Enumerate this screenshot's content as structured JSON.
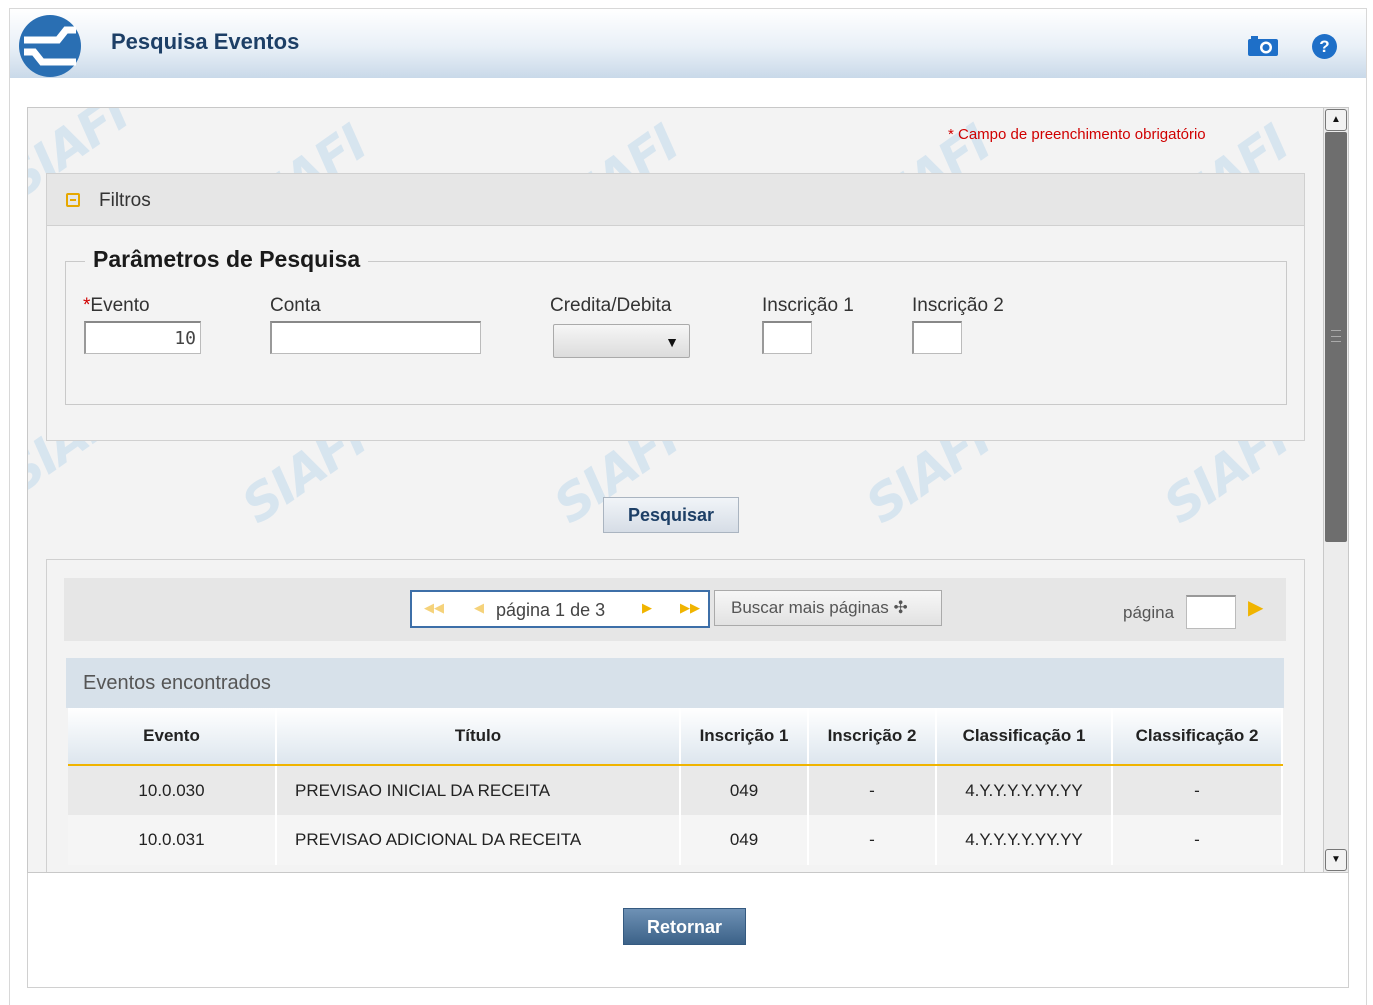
{
  "header": {
    "title": "Pesquisa Eventos",
    "help_glyph": "?"
  },
  "watermark_text": "SIAFI",
  "required_note": "* Campo de preenchimento obrigatório",
  "filters": {
    "section_label": "Filtros",
    "fieldset_legend": "Parâmetros de Pesquisa",
    "evento": {
      "label": "Evento",
      "required_mark": "*",
      "value": "10"
    },
    "conta": {
      "label": "Conta",
      "value": ""
    },
    "credita_debita": {
      "label": "Credita/Debita",
      "selected": ""
    },
    "inscricao1": {
      "label": "Inscrição 1",
      "value": ""
    },
    "inscricao2": {
      "label": "Inscrição 2",
      "value": ""
    }
  },
  "search_button": "Pesquisar",
  "pager": {
    "text": "página 1 de 3",
    "more_pages_label": "Buscar mais páginas ✣",
    "page_label": "página",
    "page_value": ""
  },
  "results": {
    "title": "Eventos encontrados",
    "columns": [
      "Evento",
      "Título",
      "Inscrição 1",
      "Inscrição 2",
      "Classificação 1",
      "Classificação 2"
    ],
    "rows": [
      [
        "10.0.030",
        "PREVISAO INICIAL DA RECEITA",
        "049",
        "-",
        "4.Y.Y.Y.Y.YY.YY",
        "-"
      ],
      [
        "10.0.031",
        "PREVISAO ADICIONAL DA RECEITA",
        "049",
        "-",
        "4.Y.Y.Y.Y.YY.YY",
        "-"
      ]
    ]
  },
  "return_button": "Retornar",
  "colors": {
    "accent": "#1d3f66",
    "required": "#d00000",
    "pager_arrow": "#f0b400"
  }
}
